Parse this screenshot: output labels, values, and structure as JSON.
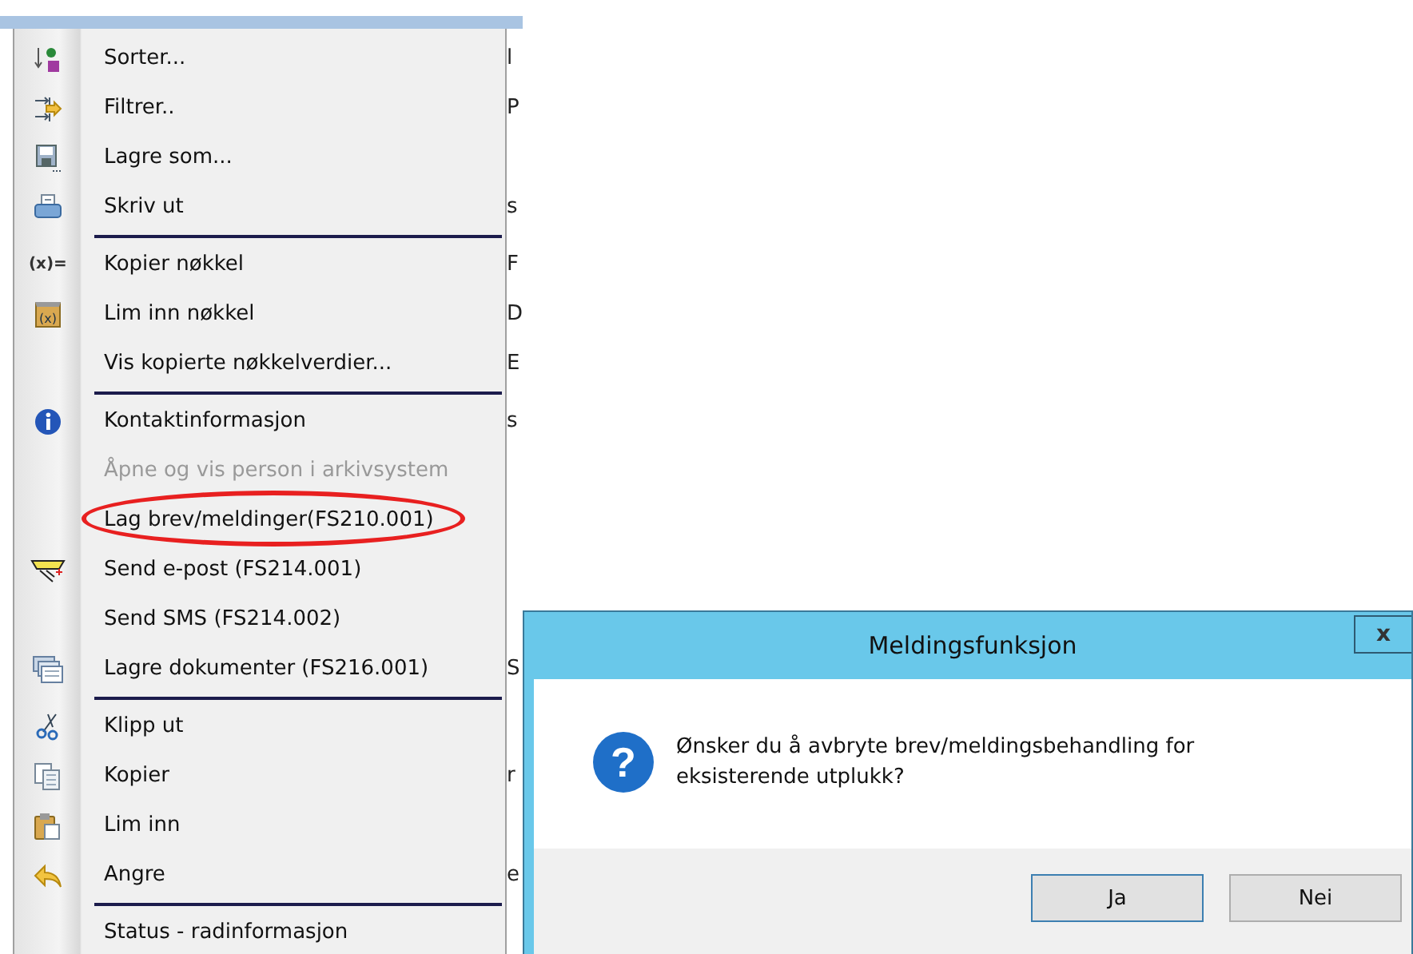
{
  "menu": {
    "items": [
      {
        "label": "Sorter...",
        "kind": "sort",
        "disabled": false,
        "separator_after": false,
        "behind": "l"
      },
      {
        "label": "Filtrer..",
        "kind": "filter",
        "disabled": false,
        "separator_after": false,
        "behind": "P"
      },
      {
        "label": "Lagre som...",
        "kind": "save",
        "disabled": false,
        "separator_after": false
      },
      {
        "label": "Skriv ut",
        "kind": "print",
        "disabled": false,
        "separator_after": true,
        "behind": "s"
      },
      {
        "label": "Kopier nøkkel",
        "kind": "keycopy",
        "icon_text": "(x)=",
        "disabled": false,
        "separator_after": false,
        "behind": "F"
      },
      {
        "label": "Lim inn nøkkel",
        "kind": "keypaste",
        "icon_text": "(x)",
        "disabled": false,
        "separator_after": false,
        "behind": "D"
      },
      {
        "label": "Vis kopierte nøkkelverdier...",
        "kind": "plain",
        "disabled": false,
        "separator_after": true,
        "behind": "E"
      },
      {
        "label": "Kontaktinformasjon",
        "kind": "info",
        "disabled": false,
        "separator_after": false,
        "behind": "s"
      },
      {
        "label": "Åpne og vis person i arkivsystem",
        "kind": "plain",
        "disabled": true,
        "separator_after": false
      },
      {
        "label": "Lag brev/meldinger(FS210.001)",
        "kind": "plain",
        "disabled": false,
        "separator_after": false,
        "circled": true
      },
      {
        "label": "Send e-post (FS214.001)",
        "kind": "email",
        "disabled": false,
        "separator_after": false
      },
      {
        "label": "Send SMS (FS214.002)",
        "kind": "plain",
        "disabled": false,
        "separator_after": false
      },
      {
        "label": "Lagre dokumenter (FS216.001)",
        "kind": "documents",
        "disabled": false,
        "separator_after": true,
        "behind": "S"
      },
      {
        "label": "Klipp ut",
        "kind": "cut",
        "disabled": false,
        "separator_after": false
      },
      {
        "label": "Kopier",
        "kind": "copy",
        "disabled": false,
        "separator_after": false,
        "behind": "r"
      },
      {
        "label": "Lim inn",
        "kind": "paste",
        "disabled": false,
        "separator_after": false
      },
      {
        "label": "Angre",
        "kind": "undo",
        "disabled": false,
        "separator_after": true,
        "behind": "e"
      },
      {
        "label": "Status - radinformasjon",
        "kind": "plain",
        "disabled": false,
        "separator_after": false
      }
    ]
  },
  "dialog": {
    "title": "Meldingsfunksjon",
    "close": "x",
    "icon_text": "?",
    "message": "Ønsker du å avbryte brev/meldingsbehandling for eksisterende utplukk?",
    "buttons": [
      {
        "label": "Ja",
        "selected": true
      },
      {
        "label": "Nei",
        "selected": false
      }
    ]
  }
}
